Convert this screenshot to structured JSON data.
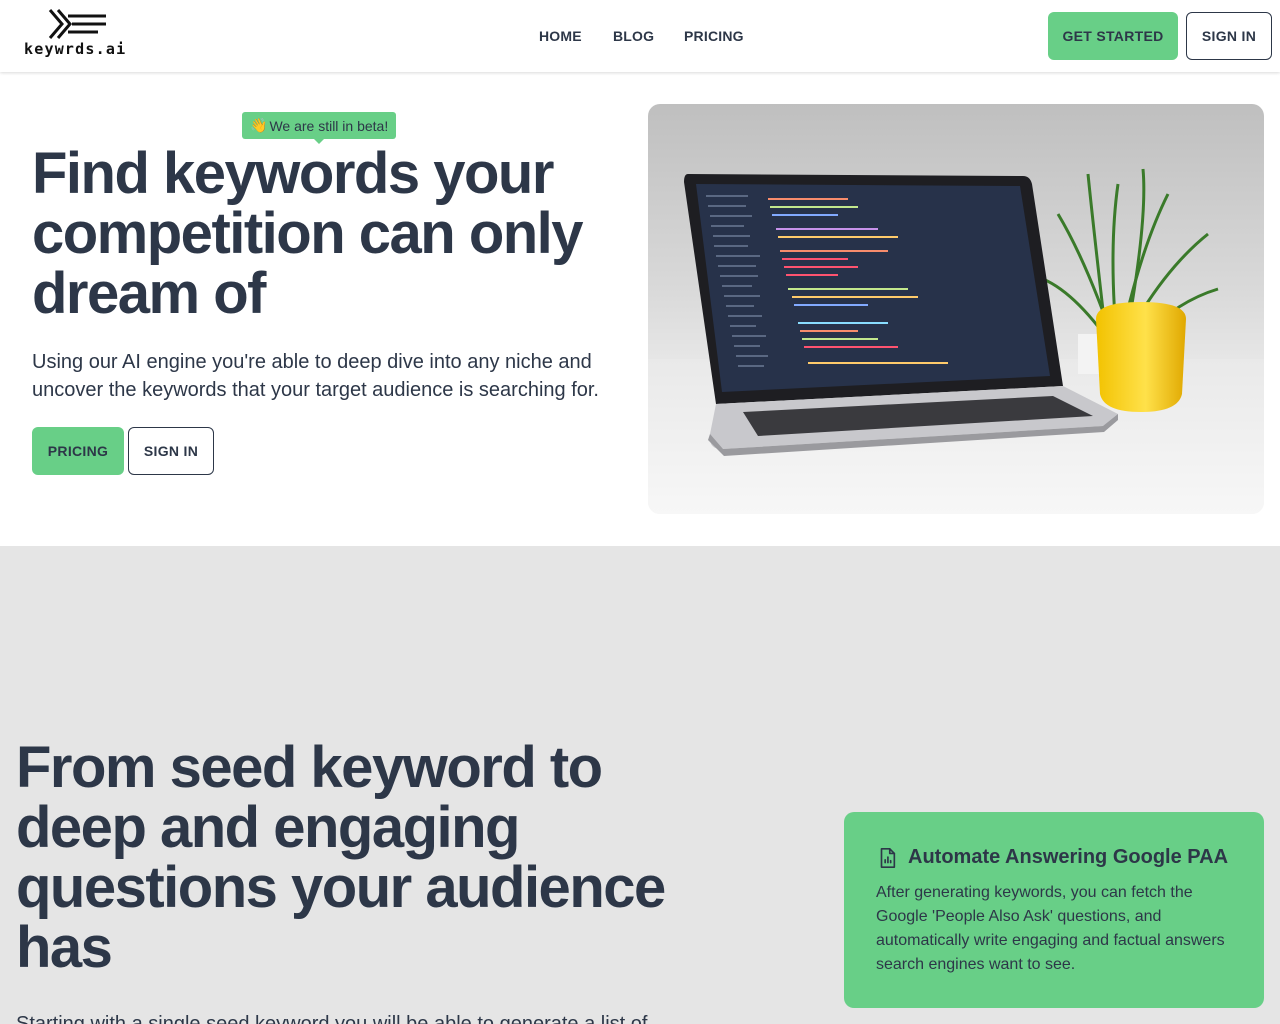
{
  "header": {
    "logo_text": "keywrds.ai",
    "nav": [
      "HOME",
      "BLOG",
      "PRICING"
    ],
    "get_started": "GET STARTED",
    "sign_in": "SIGN IN"
  },
  "hero": {
    "beta_badge": "We are still in beta!",
    "beta_emoji": "👋",
    "title": "Find keywords your competition can only dream of",
    "subtitle": "Using our AI engine you're able to deep dive into any niche and uncover the keywords that your target audience is searching for.",
    "pricing_button": "PRICING",
    "sign_in_button": "SIGN IN",
    "image_label": "laptop-with-code-photo"
  },
  "section": {
    "title": "From seed keyword to deep and engaging questions your audience has",
    "subtitle": "Starting with a single seed keyword you will be able to generate a list of hundreds of"
  },
  "card": {
    "icon": "document-chart-icon",
    "title": "Automate Answering Google PAA",
    "body": "After generating keywords, you can fetch the Google 'People Also Ask' questions, and automatically write engaging and factual answers search engines want to see."
  },
  "colors": {
    "accent": "#68cf87",
    "text": "#2d3748",
    "section_bg": "#e5e5e5"
  }
}
